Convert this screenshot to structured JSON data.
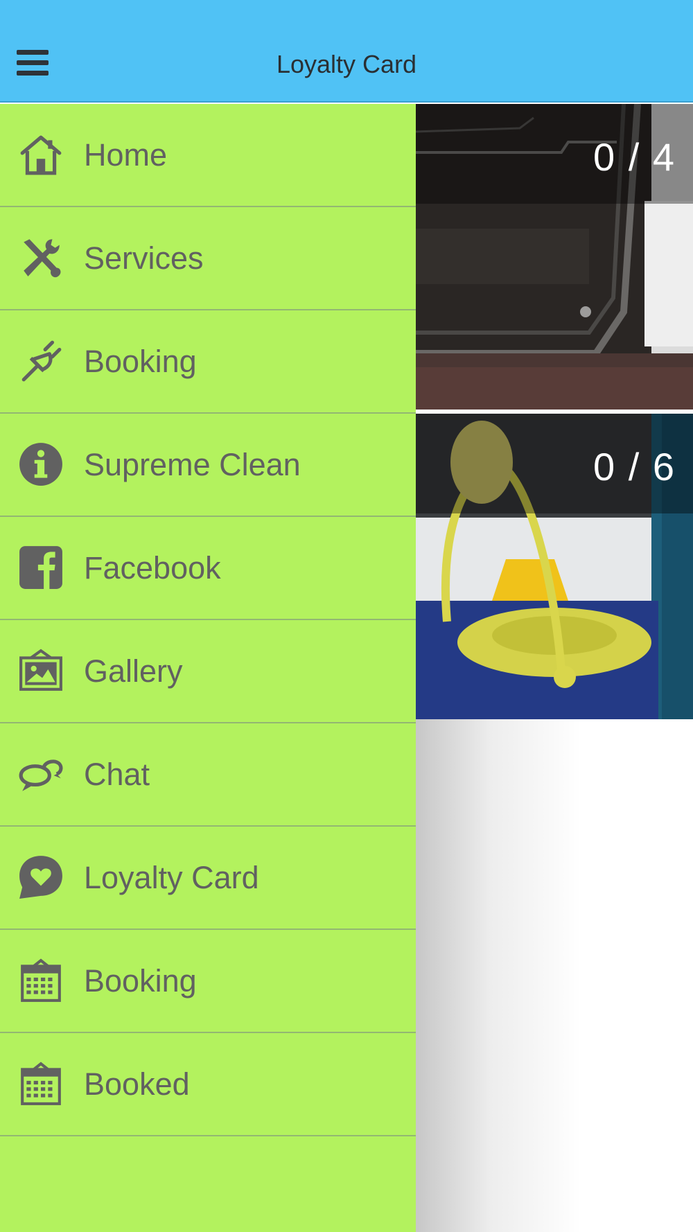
{
  "header": {
    "title": "Loyalty Card",
    "menu_icon": "hamburger-menu-icon",
    "bg_color": "#50c2f5"
  },
  "drawer": {
    "bg_color": "#b3f25e",
    "items": [
      {
        "label": "Home",
        "icon": "home-icon"
      },
      {
        "label": "Services",
        "icon": "tools-icon"
      },
      {
        "label": "Booking",
        "icon": "plug-icon"
      },
      {
        "label": "Supreme Clean",
        "icon": "info-icon"
      },
      {
        "label": "Facebook",
        "icon": "facebook-icon"
      },
      {
        "label": "Gallery",
        "icon": "gallery-icon"
      },
      {
        "label": "Chat",
        "icon": "chat-icon"
      },
      {
        "label": "Loyalty Card",
        "icon": "heart-chat-icon"
      },
      {
        "label": "Booking",
        "icon": "calendar-icon"
      },
      {
        "label": "Booked",
        "icon": "calendar-icon"
      }
    ]
  },
  "cards": [
    {
      "count": "0 / 4",
      "image": "oven-cleaning-photo"
    },
    {
      "count": "0 / 6",
      "image": "mop-bucket-photo"
    }
  ]
}
